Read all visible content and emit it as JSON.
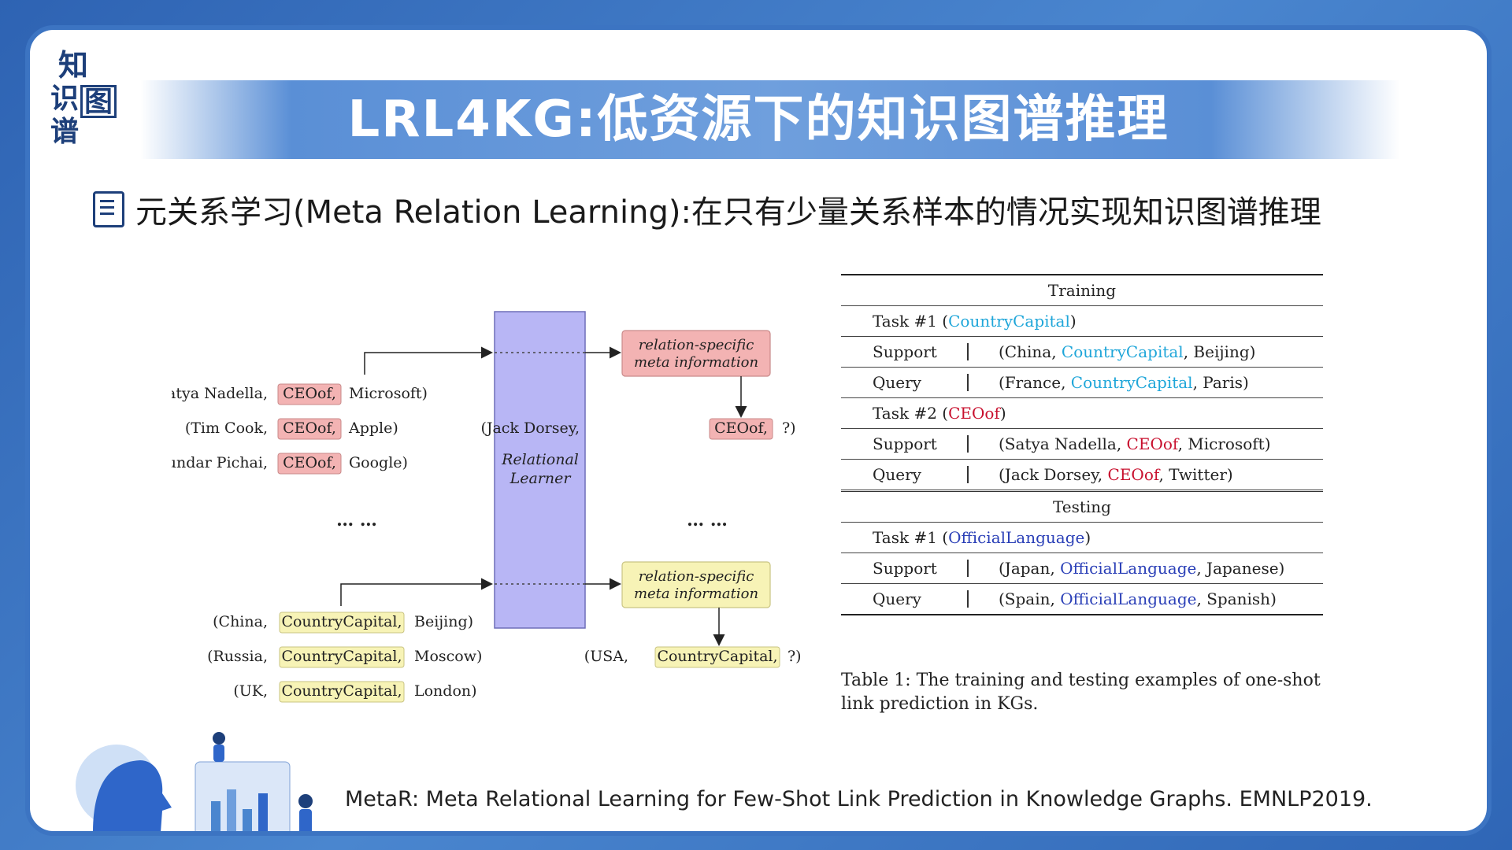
{
  "logo": {
    "chars": [
      "知",
      "识",
      "图",
      "谱"
    ]
  },
  "title": "LRL4KG:低资源下的知识图谱推理",
  "subtitle": "元关系学习(Meta Relation Learning):在只有少量关系样本的情况实现知识图谱推理",
  "diagram": {
    "learner": "Relational Learner",
    "learner_line1": "Relational",
    "learner_line2": "Learner",
    "meta_box_line1": "relation-specific",
    "meta_box_line2": "meta information",
    "ellipsis": "… …",
    "top_group": [
      {
        "head": "(Satya Nadella,",
        "rel": "CEOof,",
        "tail": "Microsoft)"
      },
      {
        "head": "(Tim Cook,",
        "rel": "CEOof,",
        "tail": "Apple)"
      },
      {
        "head": "(Sundar Pichai,",
        "rel": "CEOof,",
        "tail": "Google)"
      }
    ],
    "bottom_group": [
      {
        "head": "(China,",
        "rel": "CountryCapital,",
        "tail": "Beijing)"
      },
      {
        "head": "(Russia,",
        "rel": "CountryCapital,",
        "tail": "Moscow)"
      },
      {
        "head": "(UK,",
        "rel": "CountryCapital,",
        "tail": "London)"
      }
    ],
    "query_top": {
      "head": "(Jack Dorsey,",
      "rel": "CEOof,",
      "tail": "?)"
    },
    "query_bottom": {
      "head": "(USA,",
      "rel": "CountryCapital,",
      "tail": "?)"
    },
    "colors": {
      "red_box": "#f3b3b3",
      "yellow_box": "#f7f3b6",
      "learner": "#b8b6f5"
    }
  },
  "table": {
    "training_header": "Training",
    "testing_header": "Testing",
    "task1_label": "Task #1 (",
    "task1_rel": "CountryCapital",
    "task1_close": ")",
    "support_label": "Support",
    "query_label": "Query",
    "train_t1_support": {
      "pre": "(China, ",
      "rel": "CountryCapital",
      "post": ", Beijing)"
    },
    "train_t1_query": {
      "pre": "(France, ",
      "rel": "CountryCapital",
      "post": ", Paris)"
    },
    "task2_label": "Task #2 (",
    "task2_rel": "CEOof",
    "task2_close": ")",
    "train_t2_support": {
      "pre": "(Satya Nadella, ",
      "rel": "CEOof",
      "post": ", Microsoft)"
    },
    "train_t2_query": {
      "pre": "(Jack Dorsey, ",
      "rel": "CEOof",
      "post": ", Twitter)"
    },
    "test_task1_label": "Task #1 (",
    "test_task1_rel": "OfficialLanguage",
    "test_task1_close": ")",
    "test_t1_support": {
      "pre": "(Japan, ",
      "rel": "OfficialLanguage",
      "post": ", Japanese)"
    },
    "test_t1_query": {
      "pre": "(Spain, ",
      "rel": "OfficialLanguage",
      "post": ", Spanish)"
    }
  },
  "caption": "Table 1: The training and testing examples of one-shot link prediction in KGs.",
  "reference": "MetaR: Meta Relational Learning for Few-Shot Link Prediction in Knowledge Graphs. EMNLP2019."
}
